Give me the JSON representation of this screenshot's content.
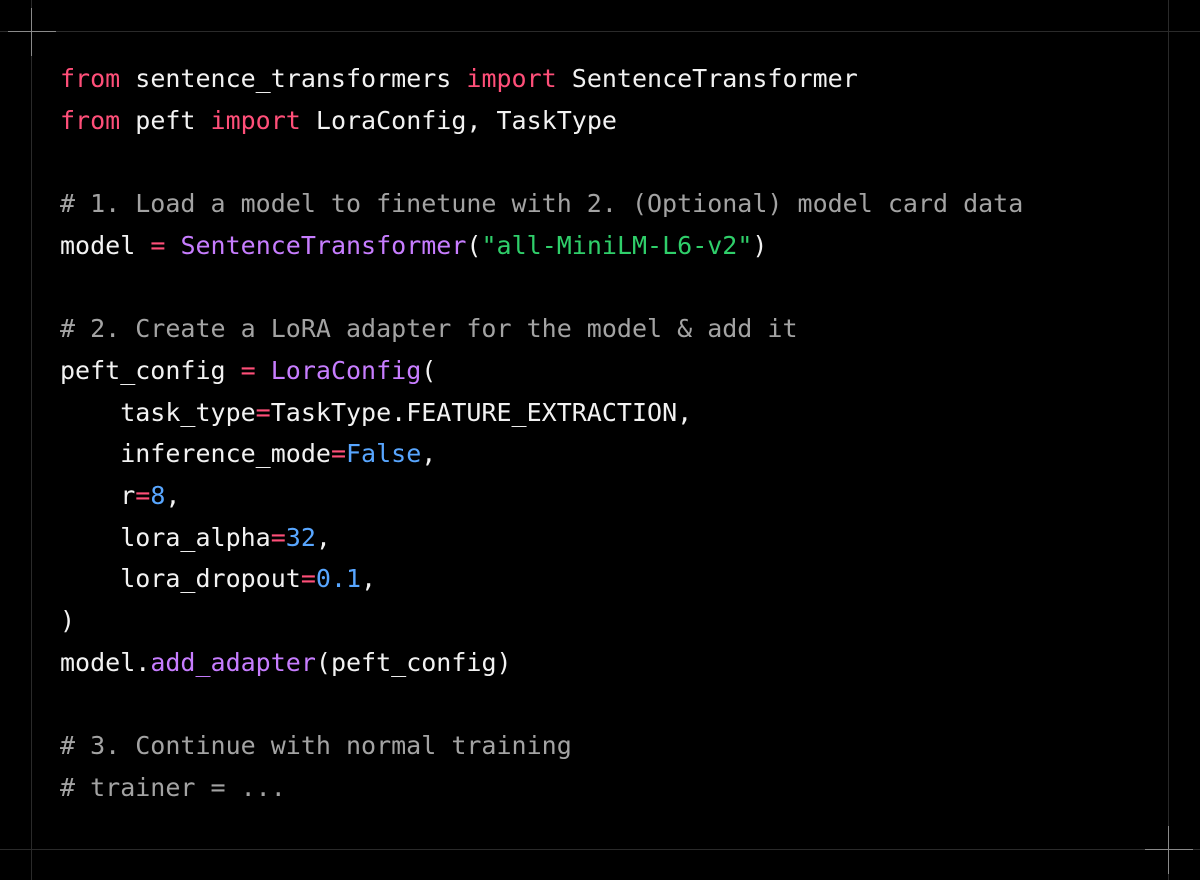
{
  "code": {
    "language": "python",
    "colors": {
      "background": "#000000",
      "keyword": "#ff4f79",
      "function": "#c77dff",
      "string": "#2fcf6a",
      "number": "#58a6ff",
      "comment": "#a3a3a3",
      "plain": "#f2f2f2"
    },
    "lines": [
      [
        {
          "t": "kw",
          "v": "from"
        },
        {
          "t": "plain",
          "v": " sentence_transformers "
        },
        {
          "t": "kw",
          "v": "import"
        },
        {
          "t": "plain",
          "v": " SentenceTransformer"
        }
      ],
      [
        {
          "t": "kw",
          "v": "from"
        },
        {
          "t": "plain",
          "v": " peft "
        },
        {
          "t": "kw",
          "v": "import"
        },
        {
          "t": "plain",
          "v": " LoraConfig, TaskType"
        }
      ],
      [],
      [
        {
          "t": "comment",
          "v": "# 1. Load a model to finetune with 2. (Optional) model card data"
        }
      ],
      [
        {
          "t": "plain",
          "v": "model "
        },
        {
          "t": "op",
          "v": "="
        },
        {
          "t": "plain",
          "v": " "
        },
        {
          "t": "fn",
          "v": "SentenceTransformer"
        },
        {
          "t": "plain",
          "v": "("
        },
        {
          "t": "str",
          "v": "\"all-MiniLM-L6-v2\""
        },
        {
          "t": "plain",
          "v": ")"
        }
      ],
      [],
      [
        {
          "t": "comment",
          "v": "# 2. Create a LoRA adapter for the model & add it"
        }
      ],
      [
        {
          "t": "plain",
          "v": "peft_config "
        },
        {
          "t": "op",
          "v": "="
        },
        {
          "t": "plain",
          "v": " "
        },
        {
          "t": "fn",
          "v": "LoraConfig"
        },
        {
          "t": "plain",
          "v": "("
        }
      ],
      [
        {
          "t": "plain",
          "v": "    task_type"
        },
        {
          "t": "op",
          "v": "="
        },
        {
          "t": "plain",
          "v": "TaskType.FEATURE_EXTRACTION,"
        }
      ],
      [
        {
          "t": "plain",
          "v": "    inference_mode"
        },
        {
          "t": "op",
          "v": "="
        },
        {
          "t": "num",
          "v": "False"
        },
        {
          "t": "plain",
          "v": ","
        }
      ],
      [
        {
          "t": "plain",
          "v": "    r"
        },
        {
          "t": "op",
          "v": "="
        },
        {
          "t": "num",
          "v": "8"
        },
        {
          "t": "plain",
          "v": ","
        }
      ],
      [
        {
          "t": "plain",
          "v": "    lora_alpha"
        },
        {
          "t": "op",
          "v": "="
        },
        {
          "t": "num",
          "v": "32"
        },
        {
          "t": "plain",
          "v": ","
        }
      ],
      [
        {
          "t": "plain",
          "v": "    lora_dropout"
        },
        {
          "t": "op",
          "v": "="
        },
        {
          "t": "num",
          "v": "0.1"
        },
        {
          "t": "plain",
          "v": ","
        }
      ],
      [
        {
          "t": "plain",
          "v": ")"
        }
      ],
      [
        {
          "t": "plain",
          "v": "model."
        },
        {
          "t": "fn",
          "v": "add_adapter"
        },
        {
          "t": "plain",
          "v": "(peft_config)"
        }
      ],
      [],
      [
        {
          "t": "comment",
          "v": "# 3. Continue with normal training"
        }
      ],
      [
        {
          "t": "comment",
          "v": "# trainer = ..."
        }
      ]
    ]
  }
}
